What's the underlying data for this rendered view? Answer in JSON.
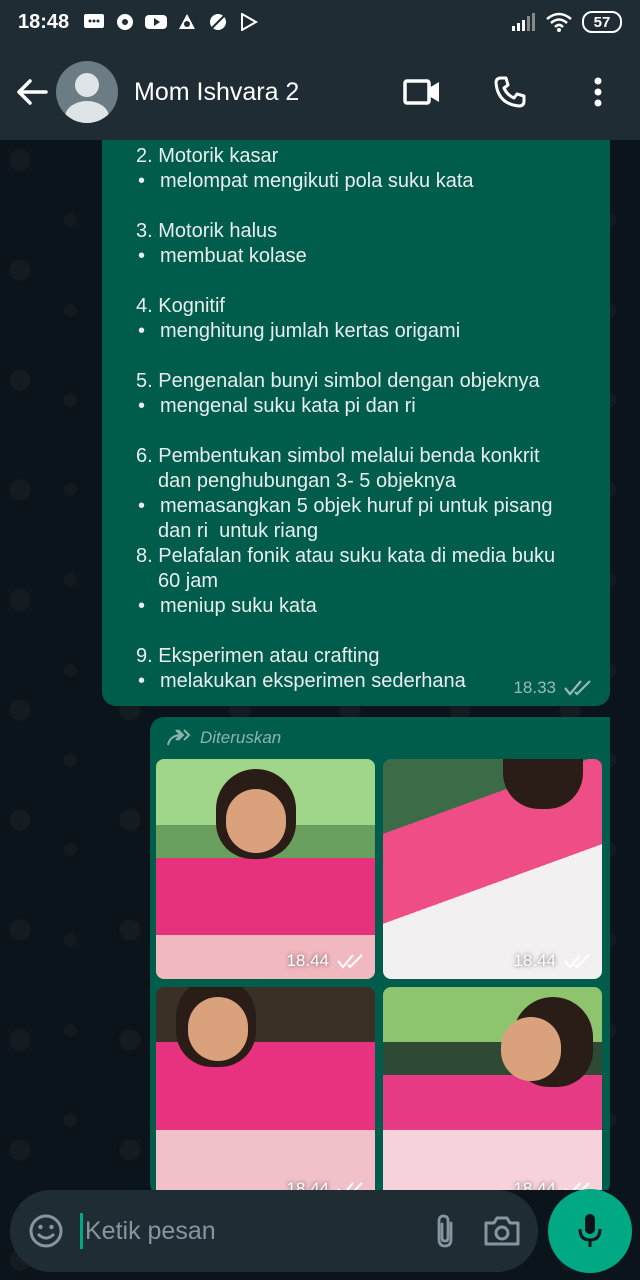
{
  "status_bar": {
    "time": "18:48",
    "battery": "57",
    "icons": [
      "message-icon",
      "chat-bubble-icon",
      "youtube-icon",
      "app-icon",
      "blocked-icon",
      "play-store-icon"
    ]
  },
  "header": {
    "contact_name": "Mom Ishvara 2",
    "icons": [
      "back-arrow-icon",
      "video-call-icon",
      "voice-call-icon",
      "more-vert-icon"
    ]
  },
  "message_text": {
    "lines": [
      {
        "type": "text",
        "text": "2. Motorik kasar"
      },
      {
        "type": "bullet",
        "text": "melompat mengikuti pola suku kata"
      },
      {
        "type": "gap"
      },
      {
        "type": "text",
        "text": "3. Motorik halus"
      },
      {
        "type": "bullet",
        "text": "membuat kolase"
      },
      {
        "type": "gap"
      },
      {
        "type": "text",
        "text": "4. Kognitif"
      },
      {
        "type": "bullet",
        "text": "menghitung jumlah kertas origami"
      },
      {
        "type": "gap"
      },
      {
        "type": "text",
        "text": "5. Pengenalan bunyi simbol dengan objeknya"
      },
      {
        "type": "bullet",
        "text": "mengenal suku kata pi dan ri"
      },
      {
        "type": "gap"
      },
      {
        "type": "text",
        "text": "6. Pembentukan simbol melalui benda konkrit"
      },
      {
        "type": "indent",
        "text": "dan penghubungan 3- 5 objeknya"
      },
      {
        "type": "bullet",
        "text": "memasangkan 5 objek huruf pi untuk pisang"
      },
      {
        "type": "indent",
        "text": "dan ri  untuk riang"
      },
      {
        "type": "text",
        "text": "8. Pelafalan fonik atau suku kata di media buku"
      },
      {
        "type": "indent",
        "text": "60 jam"
      },
      {
        "type": "bullet",
        "text": "meniup suku kata"
      },
      {
        "type": "gap"
      },
      {
        "type": "text",
        "text": "9. Eksperimen atau crafting"
      },
      {
        "type": "bullet",
        "text": "melakukan eksperimen sederhana"
      }
    ],
    "bullet_char": "•",
    "time": "18.33",
    "read_status": "double-check-icon"
  },
  "media_message": {
    "forwarded_label": "Diteruskan",
    "photos": [
      {
        "time": "18.44"
      },
      {
        "time": "18.44"
      },
      {
        "time": "18.44"
      },
      {
        "time": "18.44"
      }
    ]
  },
  "composer": {
    "placeholder": "Ketik pesan",
    "value": ""
  },
  "colors": {
    "accent": "#00a884",
    "bubble_out": "#005c4b",
    "bar": "#1f2c34",
    "background": "#0b141a"
  }
}
